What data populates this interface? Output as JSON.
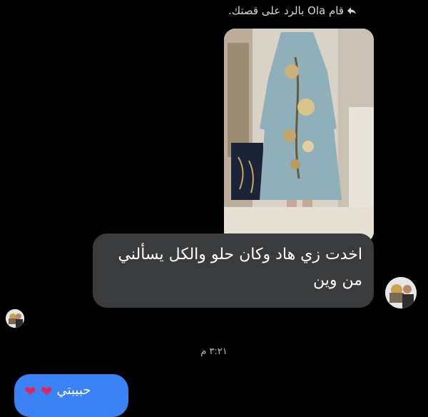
{
  "reply_header": {
    "text": "قام Ola بالرد على قصتك.",
    "icon": "reply-arrow-icon"
  },
  "story": {
    "icon": "story-photo"
  },
  "message": {
    "text": "اخدت زي هاد وكان حلو والكل يسألني من وين"
  },
  "timestamp": {
    "text": "٣:٢١ م"
  },
  "sent_message": {
    "text": "حبيبتي",
    "hearts": [
      "❤",
      "❤"
    ],
    "color": "#3b82f6"
  },
  "colors": {
    "background": "#000000",
    "received_bubble": "#3a3b3c",
    "sent_bubble": "#3b82f6",
    "heart": "#e0245e"
  }
}
